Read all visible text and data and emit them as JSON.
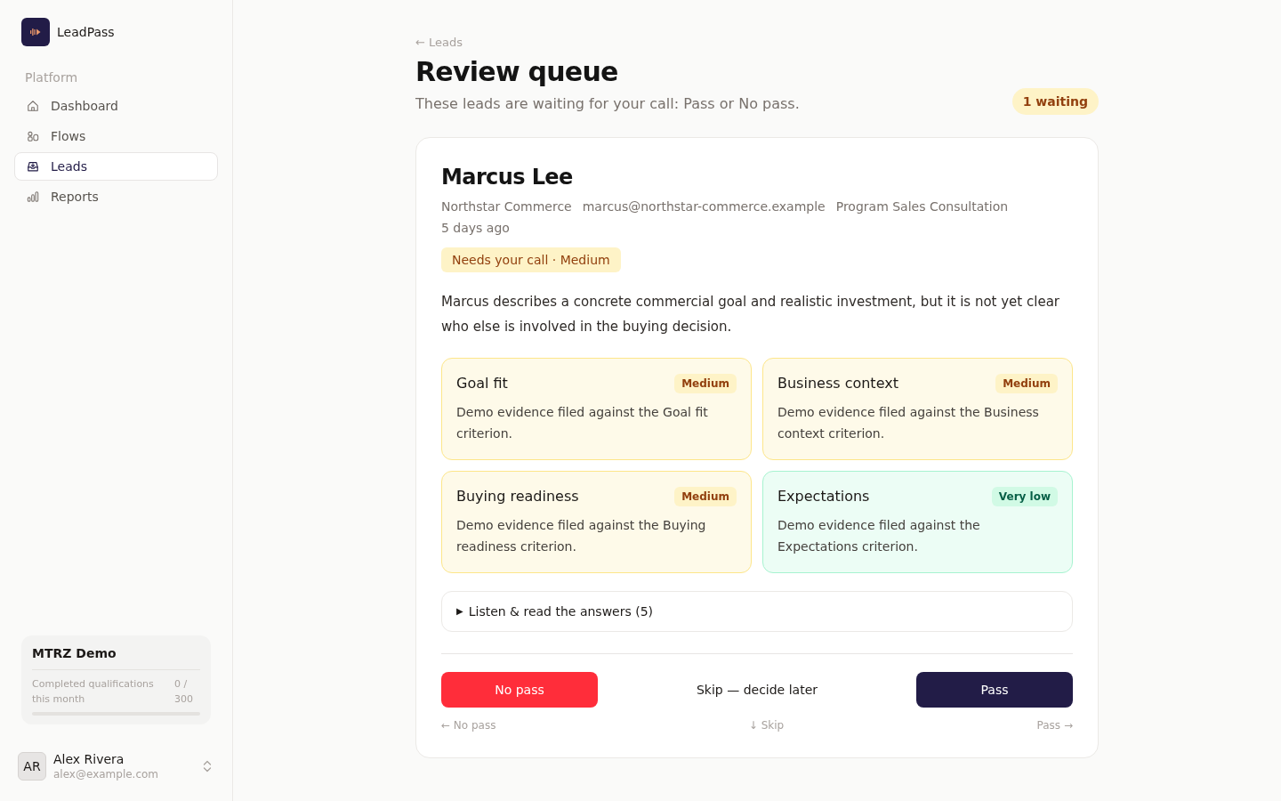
{
  "sidebar": {
    "brand": "LeadPass",
    "section_label": "Platform",
    "nav": [
      {
        "label": "Dashboard",
        "selected": false
      },
      {
        "label": "Flows",
        "selected": false
      },
      {
        "label": "Leads",
        "selected": true
      },
      {
        "label": "Reports",
        "selected": false
      }
    ],
    "plan": {
      "name": "MTRZ Demo",
      "usage_label": "Completed qualifications this month",
      "usage_count": "0 / 300",
      "level": 0
    },
    "user": {
      "initials": "AR",
      "name": "Alex Rivera",
      "email": "alex@example.com"
    }
  },
  "header": {
    "back_link": "← Leads",
    "title": "Review queue",
    "subtitle": "These leads are waiting for your call: Pass or No pass.",
    "waiting_badge": "1 waiting"
  },
  "lead": {
    "name": "Marcus Lee",
    "meta": [
      "Northstar Commerce",
      "marcus@northstar-commerce.example",
      "Program Sales Consultation",
      "5 days ago"
    ],
    "status_badge": "Needs your call · Medium",
    "summary": "Marcus describes a concrete commercial goal and realistic investment, but it is not yet clear who else is involved in the buying decision.",
    "criteria": [
      {
        "title": "Goal fit",
        "rating": "Medium",
        "color": "#fef3c7",
        "evidence": "Demo evidence filed against the Goal fit criterion."
      },
      {
        "title": "Business context",
        "rating": "Medium",
        "color": "#fef3c7",
        "evidence": "Demo evidence filed against the Business context criterion."
      },
      {
        "title": "Buying readiness",
        "rating": "Medium",
        "color": "#fef3c7",
        "evidence": "Demo evidence filed against the Buying readiness criterion."
      },
      {
        "title": "Expectations",
        "rating": "Very low",
        "color": "#d1fae5",
        "evidence": "Demo evidence filed against the Expectations criterion."
      }
    ],
    "answers_toggle": {
      "marker": "▶",
      "label": "Listen & read the answers (5)"
    },
    "actions": [
      {
        "label": "No pass",
        "kind": "reject"
      },
      {
        "label": "Skip — decide later",
        "kind": "skip"
      },
      {
        "label": "Pass",
        "kind": "accept"
      }
    ],
    "shortcuts": [
      "← No pass",
      "↓ Skip",
      "Pass →"
    ]
  }
}
